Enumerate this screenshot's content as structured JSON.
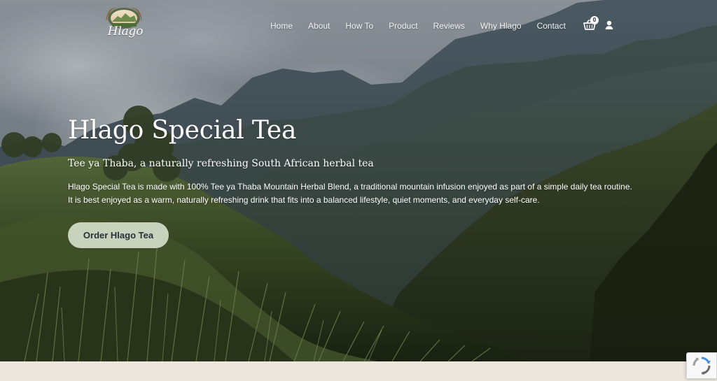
{
  "header": {
    "logo_text": "Hlago",
    "nav": [
      {
        "label": "Home"
      },
      {
        "label": "About"
      },
      {
        "label": "How To"
      },
      {
        "label": "Product"
      },
      {
        "label": "Reviews"
      },
      {
        "label": "Why Hlago"
      },
      {
        "label": "Contact"
      }
    ],
    "cart_count": "0",
    "icons": {
      "cart": "shopping-basket-icon",
      "account": "user-account-icon"
    }
  },
  "hero": {
    "title": "Hlago Special Tea",
    "subtitle": "Tee ya Thaba, a naturally refreshing South African herbal tea",
    "body": "Hlago Special Tea is made with 100% Tee ya Thaba Mountain Herbal Blend, a traditional mountain infusion enjoyed as part of a simple daily tea routine. It is best enjoyed as a warm, naturally refreshing drink that fits into a balanced lifestyle, quiet moments, and everyday self-care.",
    "cta_label": "Order Hlago Tea"
  },
  "widgets": {
    "recaptcha_icon": "recaptcha-icon"
  },
  "colors": {
    "cta_background": "#c9d2bc",
    "cta_text": "#26313a",
    "page_band": "#ece6dd"
  }
}
